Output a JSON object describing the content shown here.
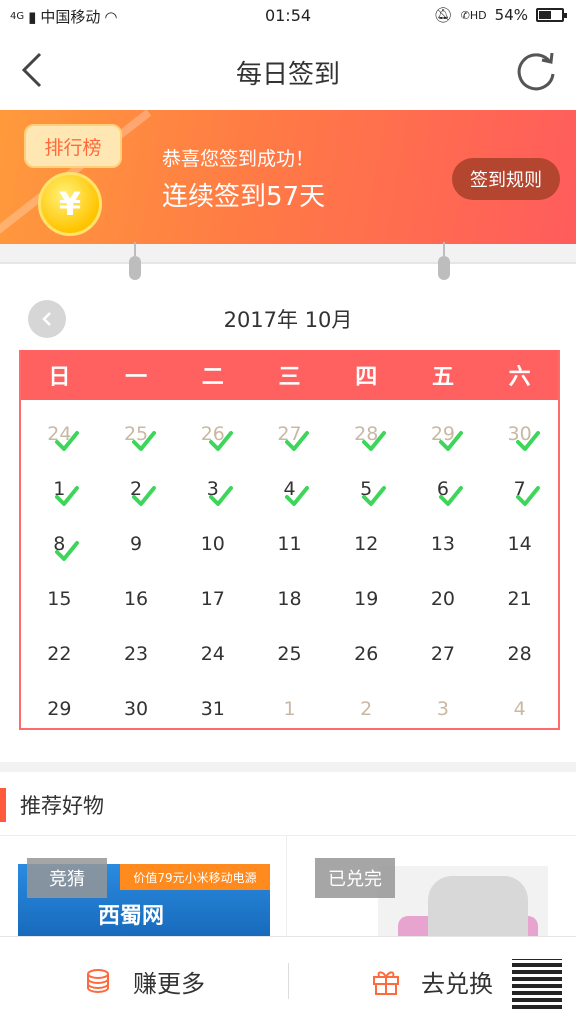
{
  "status_bar": {
    "carrier": "中国移动",
    "network": "4G",
    "time": "01:54",
    "battery_percent": "54%",
    "battery_level": 0.54,
    "hd_label": "HD"
  },
  "nav": {
    "title": "每日签到"
  },
  "banner": {
    "rank_label": "排行榜",
    "coin_symbol": "¥",
    "success_text": "恭喜您签到成功！",
    "streak_text": "连续签到57天",
    "rules_button": "签到规则"
  },
  "calendar": {
    "month_label": "2017年 10月",
    "weekdays": [
      "日",
      "一",
      "二",
      "三",
      "四",
      "五",
      "六"
    ],
    "days": [
      {
        "d": "24",
        "muted": true,
        "checked": true
      },
      {
        "d": "25",
        "muted": true,
        "checked": true
      },
      {
        "d": "26",
        "muted": true,
        "checked": true
      },
      {
        "d": "27",
        "muted": true,
        "checked": true
      },
      {
        "d": "28",
        "muted": true,
        "checked": true
      },
      {
        "d": "29",
        "muted": true,
        "checked": true
      },
      {
        "d": "30",
        "muted": true,
        "checked": true
      },
      {
        "d": "1",
        "muted": false,
        "checked": true
      },
      {
        "d": "2",
        "muted": false,
        "checked": true
      },
      {
        "d": "3",
        "muted": false,
        "checked": true
      },
      {
        "d": "4",
        "muted": false,
        "checked": true
      },
      {
        "d": "5",
        "muted": false,
        "checked": true
      },
      {
        "d": "6",
        "muted": false,
        "checked": true
      },
      {
        "d": "7",
        "muted": false,
        "checked": true
      },
      {
        "d": "8",
        "muted": false,
        "checked": true
      },
      {
        "d": "9",
        "muted": false,
        "checked": false
      },
      {
        "d": "10",
        "muted": false,
        "checked": false
      },
      {
        "d": "11",
        "muted": false,
        "checked": false
      },
      {
        "d": "12",
        "muted": false,
        "checked": false
      },
      {
        "d": "13",
        "muted": false,
        "checked": false
      },
      {
        "d": "14",
        "muted": false,
        "checked": false
      },
      {
        "d": "15",
        "muted": false,
        "checked": false
      },
      {
        "d": "16",
        "muted": false,
        "checked": false
      },
      {
        "d": "17",
        "muted": false,
        "checked": false
      },
      {
        "d": "18",
        "muted": false,
        "checked": false
      },
      {
        "d": "19",
        "muted": false,
        "checked": false
      },
      {
        "d": "20",
        "muted": false,
        "checked": false
      },
      {
        "d": "21",
        "muted": false,
        "checked": false
      },
      {
        "d": "22",
        "muted": false,
        "checked": false
      },
      {
        "d": "23",
        "muted": false,
        "checked": false
      },
      {
        "d": "24",
        "muted": false,
        "checked": false
      },
      {
        "d": "25",
        "muted": false,
        "checked": false
      },
      {
        "d": "26",
        "muted": false,
        "checked": false
      },
      {
        "d": "27",
        "muted": false,
        "checked": false
      },
      {
        "d": "28",
        "muted": false,
        "checked": false
      },
      {
        "d": "29",
        "muted": false,
        "checked": false
      },
      {
        "d": "30",
        "muted": false,
        "checked": false
      },
      {
        "d": "31",
        "muted": false,
        "checked": false
      },
      {
        "d": "1",
        "muted": true,
        "checked": false
      },
      {
        "d": "2",
        "muted": true,
        "checked": false
      },
      {
        "d": "3",
        "muted": true,
        "checked": false
      },
      {
        "d": "4",
        "muted": true,
        "checked": false
      }
    ]
  },
  "recommend": {
    "title": "推荐好物",
    "products": [
      {
        "tag": "竞猜",
        "promo": "价值79元小米移动电源",
        "brand": "西蜀网"
      },
      {
        "tag": "已兑完"
      }
    ]
  },
  "bottom_bar": {
    "earn_label": "赚更多",
    "redeem_label": "去兑换"
  },
  "colors": {
    "accent": "#ff6060",
    "check": "#3dd65a",
    "rules_button": "#b4452f"
  }
}
